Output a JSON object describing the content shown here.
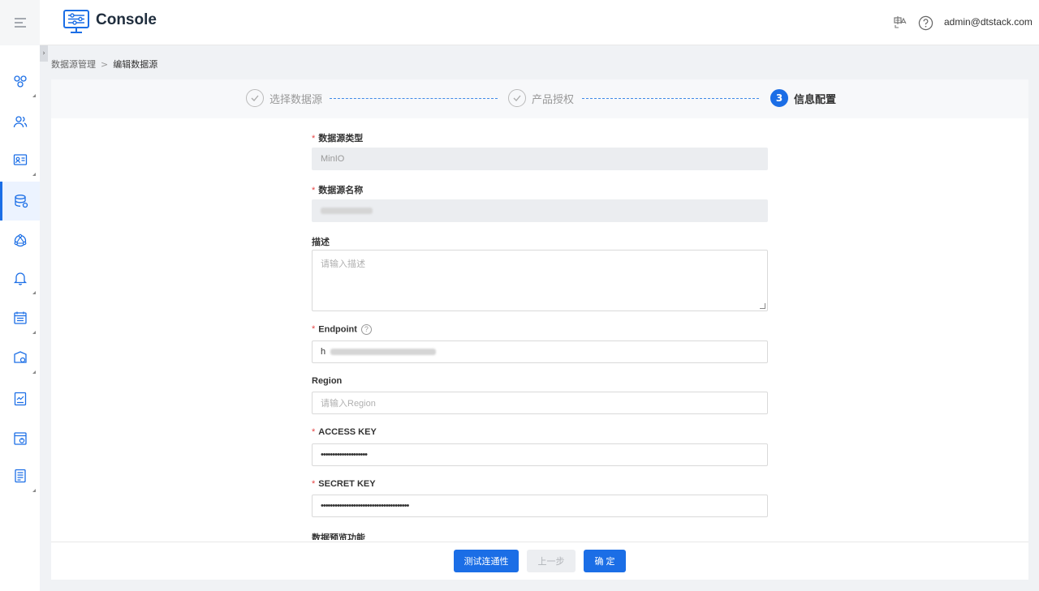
{
  "header": {
    "menu_icon": "menu-icon",
    "logo_icon": "console-logo-icon",
    "title": "Console",
    "lang_icon": "language-icon",
    "help_icon": "help-circle-icon",
    "user": "admin@dtstack.com"
  },
  "sidebar": {
    "items": [
      {
        "icon": "cluster-icon"
      },
      {
        "icon": "users-icon"
      },
      {
        "icon": "id-card-icon"
      },
      {
        "icon": "database-icon",
        "active": true
      },
      {
        "icon": "network-icon"
      },
      {
        "icon": "bell-icon"
      },
      {
        "icon": "calendar-list-icon"
      },
      {
        "icon": "folder-settings-icon"
      },
      {
        "icon": "report-chart-icon"
      },
      {
        "icon": "window-power-icon"
      },
      {
        "icon": "document-list-icon"
      }
    ],
    "collapse_glyph": "›"
  },
  "breadcrumb": {
    "parent": "数据源管理",
    "separator": ">",
    "current": "编辑数据源"
  },
  "steps": [
    {
      "label": "选择数据源",
      "status": "done"
    },
    {
      "label": "产品授权",
      "status": "done"
    },
    {
      "label": "信息配置",
      "status": "active",
      "number": "3"
    }
  ],
  "form": {
    "required_mark": "*",
    "type_label": "数据源类型",
    "type_value": "MinIO",
    "name_label": "数据源名称",
    "desc_label": "描述",
    "desc_placeholder": "请输入描述",
    "endpoint_label": "Endpoint",
    "endpoint_help": "?",
    "endpoint_value_prefix": "h",
    "region_label": "Region",
    "region_placeholder": "请输入Region",
    "access_label": "ACCESS KEY",
    "access_value": "••••••••••••••••••••",
    "secret_label": "SECRET KEY",
    "secret_value": "••••••••••••••••••••••••••••••••••••••",
    "preview_label": "数据预览功能"
  },
  "footer": {
    "test_button": "测试连通性",
    "prev_button": "上一步",
    "confirm_button": "确 定"
  },
  "colors": {
    "primary": "#1b6ee6",
    "required": "#e54545"
  }
}
